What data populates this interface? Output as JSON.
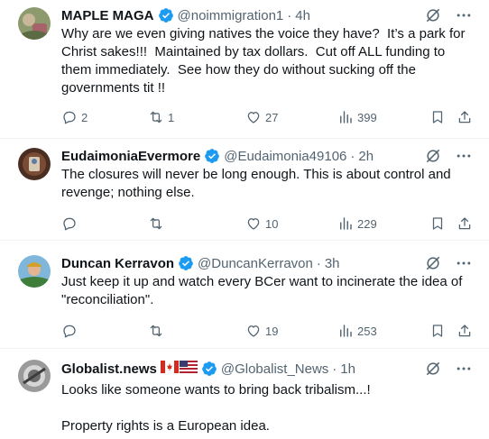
{
  "tweets": [
    {
      "name": "MAPLE MAGA",
      "handle": "@noimmigration1",
      "time": "4h",
      "text": "Why are we even giving natives the voice they have?  It’s a park for Christ sakes!!!  Maintained by tax dollars.  Cut off ALL funding to them immediately.  See how they do without sucking off the governments tit !!",
      "replies": "2",
      "reposts": "1",
      "likes": "27",
      "views": "399"
    },
    {
      "name": "EudaimoniaEvermore",
      "handle": "@Eudaimonia49106",
      "time": "2h",
      "text": "The closures will never be long enough. This is about control and revenge; nothing else.",
      "replies": "",
      "reposts": "",
      "likes": "10",
      "views": "229"
    },
    {
      "name": "Duncan Kerravon",
      "handle": "@DuncanKerravon",
      "time": "3h",
      "text": "Just keep it up and watch every BCer want to incinerate the idea of \"reconciliation\".",
      "replies": "",
      "reposts": "",
      "likes": "19",
      "views": "253"
    },
    {
      "name": "Globalist.news",
      "handle": "@Globalist_News",
      "time": "1h",
      "text": "Looks like someone wants to bring back tribalism...!\n\nProperty rights is a European idea.",
      "replies": "",
      "reposts": "",
      "likes": "",
      "views": ""
    }
  ],
  "separator": "·",
  "icons": {
    "verified": "verified-badge-icon",
    "grok": "grok-icon",
    "more": "more-icon",
    "reply": "reply-icon",
    "repost": "repost-icon",
    "like": "like-icon",
    "views": "views-icon",
    "bookmark": "bookmark-icon",
    "share": "share-icon",
    "flag_ca": "canada-flag-icon",
    "flag_us": "us-flag-icon"
  },
  "colors": {
    "verified": "#1d9bf0",
    "text": "#0f1419",
    "secondary": "#536471",
    "divider": "#eff3f4"
  }
}
